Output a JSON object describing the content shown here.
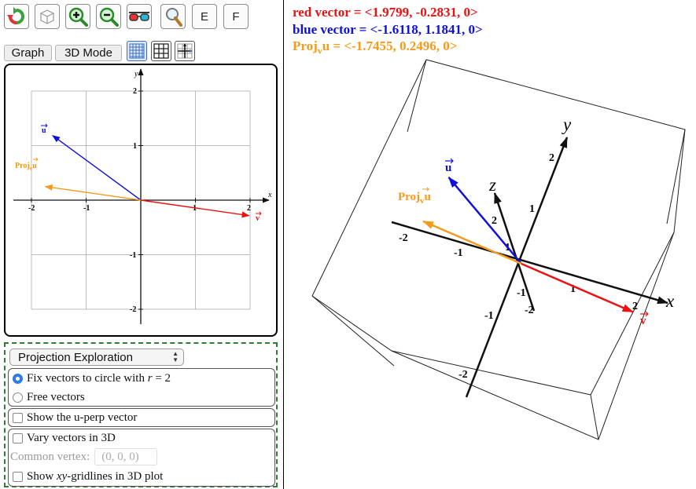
{
  "toolbar": {
    "e_label": "E",
    "f_label": "F"
  },
  "tabs": {
    "graph_label": "Graph",
    "mode3d_label": "3D Mode"
  },
  "graph2d": {
    "x_label": "x",
    "y_label": "y",
    "x_ticks": [
      "-2",
      "-1",
      "1",
      "2"
    ],
    "y_ticks": [
      "2",
      "1",
      "-1",
      "-2"
    ],
    "u_label": "u",
    "v_label": "v",
    "proj_label": "Proj",
    "proj_sub": "v",
    "proj_main": "u"
  },
  "controls": {
    "mode_value": "Projection Exploration",
    "fix_label_pre": "Fix vectors to circle with ",
    "fix_r": "r",
    "fix_label_post": " = 2",
    "free_label": "Free vectors",
    "uperp_label": "Show the u-perp vector",
    "vary3d_label": "Vary vectors in 3D",
    "vertex_label": "Common vertex:",
    "vertex_value": "(0, 0, 0)",
    "grid_label_pre": "Show ",
    "grid_label_xy": "xy",
    "grid_label_post": "-gridlines in 3D plot"
  },
  "readouts": {
    "red": "red vector = <1.9799, -0.2831, 0>",
    "blue": "blue vector  = <-1.6118, 1.1841, 0>",
    "proj_pre": "Proj",
    "proj_sub": "v",
    "proj_main": "u",
    "proj_post": " = <-1.7455, 0.2496, 0>"
  },
  "graph3d": {
    "x_label": "x",
    "y_label": "y",
    "z_label": "z",
    "x_ticks": [
      "-2",
      "-1",
      "1",
      "2"
    ],
    "y_ticks": [
      "2",
      "1",
      "-1",
      "-2"
    ],
    "z_ticks": [
      "2",
      "1",
      "-1",
      "-2"
    ]
  },
  "vectors": {
    "red": [
      1.9799,
      -0.2831
    ],
    "blue": [
      -1.6118,
      1.1841
    ],
    "proj": [
      -1.7455,
      0.2496
    ]
  },
  "colors": {
    "red": "#ee1111",
    "blue": "#1111dd",
    "orange": "#f59a1b",
    "green_dash": "#2e7d32",
    "radio_on": "#2f7de1"
  }
}
